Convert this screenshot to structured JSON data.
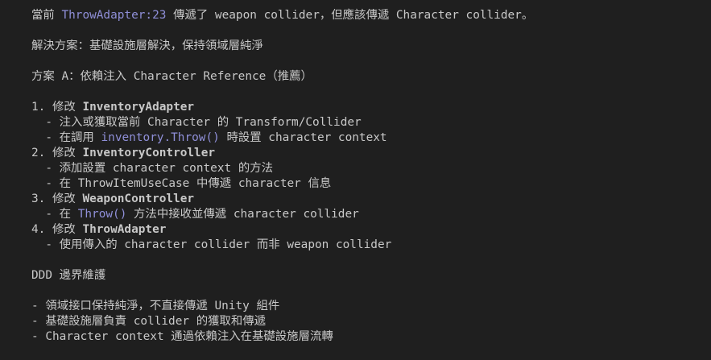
{
  "lines": [
    {
      "segs": [
        {
          "t": "當前 "
        },
        {
          "t": "ThrowAdapter:23",
          "k": "hl",
          "name": "file-reference-link",
          "interactable": true
        },
        {
          "t": " 傳遞了 weapon collider，但應該傳遞 Character collider。"
        }
      ]
    },
    {
      "segs": []
    },
    {
      "segs": [
        {
          "t": "解決方案：基礎設施層解決，保持領域層純淨"
        }
      ]
    },
    {
      "segs": []
    },
    {
      "segs": [
        {
          "t": "方案 A：依賴注入 Character Reference（推薦）"
        }
      ]
    },
    {
      "segs": []
    },
    {
      "segs": [
        {
          "t": "1. 修改 "
        },
        {
          "t": "InventoryAdapter",
          "k": "b"
        }
      ]
    },
    {
      "segs": [
        {
          "t": "  - 注入或獲取當前 Character 的 Transform/Collider"
        }
      ]
    },
    {
      "segs": [
        {
          "t": "  - 在調用 "
        },
        {
          "t": "inventory.Throw()",
          "k": "hl"
        },
        {
          "t": " 時設置 character context"
        }
      ]
    },
    {
      "segs": [
        {
          "t": "2. 修改 "
        },
        {
          "t": "InventoryController",
          "k": "b"
        }
      ]
    },
    {
      "segs": [
        {
          "t": "  - 添加設置 character context 的方法"
        }
      ]
    },
    {
      "segs": [
        {
          "t": "  - 在 ThrowItemUseCase 中傳遞 character 信息"
        }
      ]
    },
    {
      "segs": [
        {
          "t": "3. 修改 "
        },
        {
          "t": "WeaponController",
          "k": "b"
        }
      ]
    },
    {
      "segs": [
        {
          "t": "  - 在 "
        },
        {
          "t": "Throw()",
          "k": "hl"
        },
        {
          "t": " 方法中接收並傳遞 character collider"
        }
      ]
    },
    {
      "segs": [
        {
          "t": "4. 修改 "
        },
        {
          "t": "ThrowAdapter",
          "k": "b"
        }
      ]
    },
    {
      "segs": [
        {
          "t": "  - 使用傳入的 character collider 而非 weapon collider"
        }
      ]
    },
    {
      "segs": []
    },
    {
      "segs": [
        {
          "t": "DDD 邊界維護"
        }
      ]
    },
    {
      "segs": []
    },
    {
      "segs": [
        {
          "t": "- 領域接口保持純淨，不直接傳遞 Unity 組件"
        }
      ]
    },
    {
      "segs": [
        {
          "t": "- 基礎設施層負責 collider 的獲取和傳遞"
        }
      ]
    },
    {
      "segs": [
        {
          "t": "- Character context 通過依賴注入在基礎設施層流轉"
        }
      ]
    }
  ],
  "colors": {
    "background": "#1f1f1f",
    "text": "#c8c8c8",
    "code_highlight": "#8f8fd8"
  }
}
